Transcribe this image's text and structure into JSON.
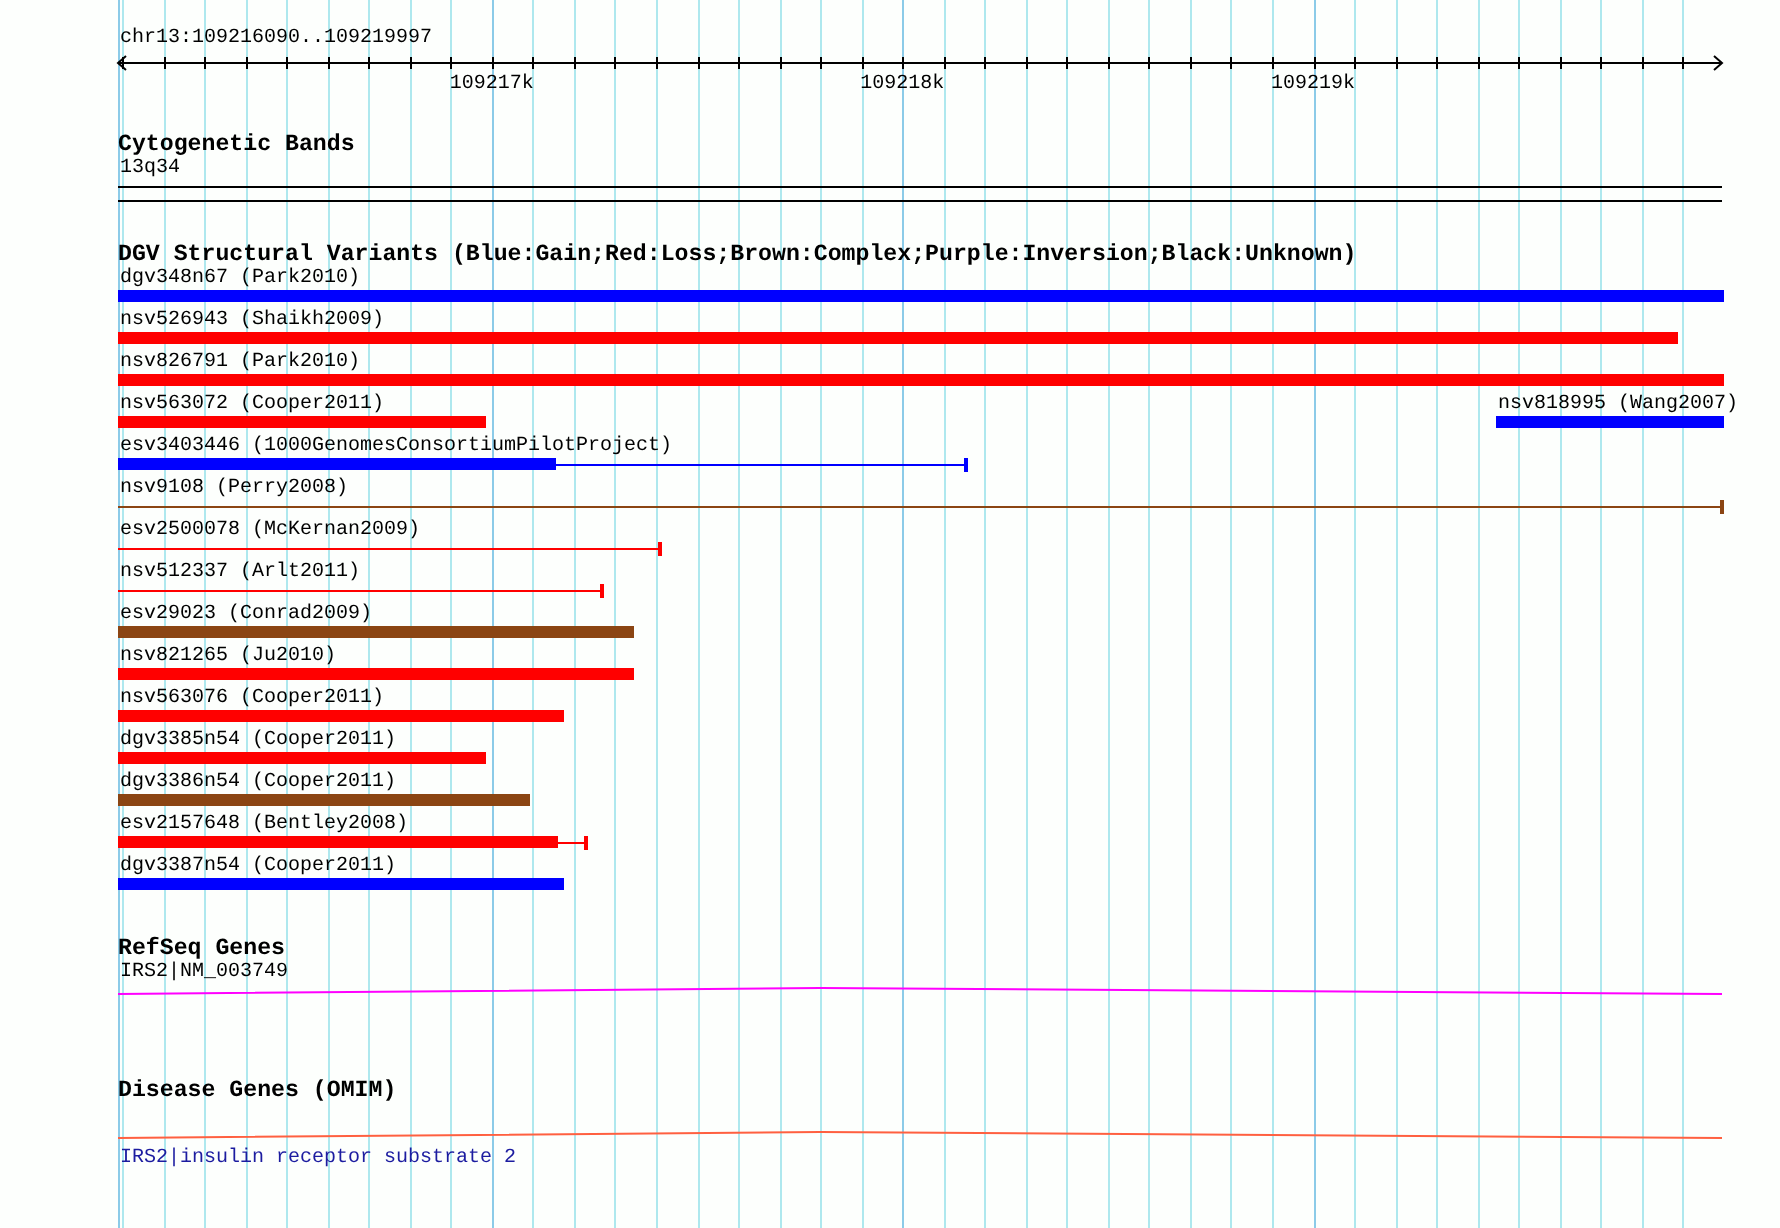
{
  "location": "chr13:109216090..109219997",
  "ruler": {
    "ticks": [
      "109217k",
      "109218k",
      "109219k"
    ]
  },
  "tracks": [
    {
      "kind": "bands",
      "title": "Cytogenetic Bands",
      "label": "13q34"
    },
    {
      "kind": "variants",
      "title": "DGV Structural Variants (Blue:Gain;Red:Loss;Brown:Complex;Purple:Inversion;Black:Unknown)",
      "rows": [
        {
          "items": [
            {
              "label": "dgv348n67 (Park2010)",
              "color": "#0000ff",
              "kind": "bar"
            }
          ]
        },
        {
          "items": [
            {
              "label": "nsv526943 (Shaikh2009)",
              "color": "#ff0000",
              "kind": "bar"
            }
          ]
        },
        {
          "items": [
            {
              "label": "nsv826791 (Park2010)",
              "color": "#ff0000",
              "kind": "bar"
            }
          ]
        },
        {
          "items": [
            {
              "label": "nsv563072 (Cooper2011)",
              "color": "#ff0000",
              "kind": "bar"
            },
            {
              "label": "nsv818995 (Wang2007)",
              "color": "#0000ff",
              "kind": "bar"
            }
          ]
        },
        {
          "items": [
            {
              "label": "esv3403446 (1000GenomesConsortiumPilotProject)",
              "color": "#0000ff",
              "kind": "bar-tail"
            }
          ]
        },
        {
          "items": [
            {
              "label": "nsv9108 (Perry2008)",
              "color": "#8b4513",
              "kind": "line"
            }
          ]
        },
        {
          "items": [
            {
              "label": "esv2500078 (McKernan2009)",
              "color": "#ff0000",
              "kind": "line"
            }
          ]
        },
        {
          "items": [
            {
              "label": "nsv512337 (Arlt2011)",
              "color": "#ff0000",
              "kind": "line"
            }
          ]
        },
        {
          "items": [
            {
              "label": "esv29023 (Conrad2009)",
              "color": "#8b4513",
              "kind": "bar"
            }
          ]
        },
        {
          "items": [
            {
              "label": "nsv821265 (Ju2010)",
              "color": "#ff0000",
              "kind": "bar"
            }
          ]
        },
        {
          "items": [
            {
              "label": "nsv563076 (Cooper2011)",
              "color": "#ff0000",
              "kind": "bar"
            }
          ]
        },
        {
          "items": [
            {
              "label": "dgv3385n54 (Cooper2011)",
              "color": "#ff0000",
              "kind": "bar"
            }
          ]
        },
        {
          "items": [
            {
              "label": "dgv3386n54 (Cooper2011)",
              "color": "#8b4513",
              "kind": "bar"
            }
          ]
        },
        {
          "items": [
            {
              "label": "esv2157648 (Bentley2008)",
              "color": "#ff0000",
              "kind": "bar-tail"
            }
          ]
        },
        {
          "items": [
            {
              "label": "dgv3387n54 (Cooper2011)",
              "color": "#0000ff",
              "kind": "bar"
            }
          ]
        }
      ]
    },
    {
      "kind": "gene",
      "title": "RefSeq Genes",
      "label": "IRS2|NM_003749"
    },
    {
      "kind": "disease",
      "title": "Disease Genes (OMIM)",
      "label": "IRS2|insulin receptor substrate 2"
    }
  ]
}
